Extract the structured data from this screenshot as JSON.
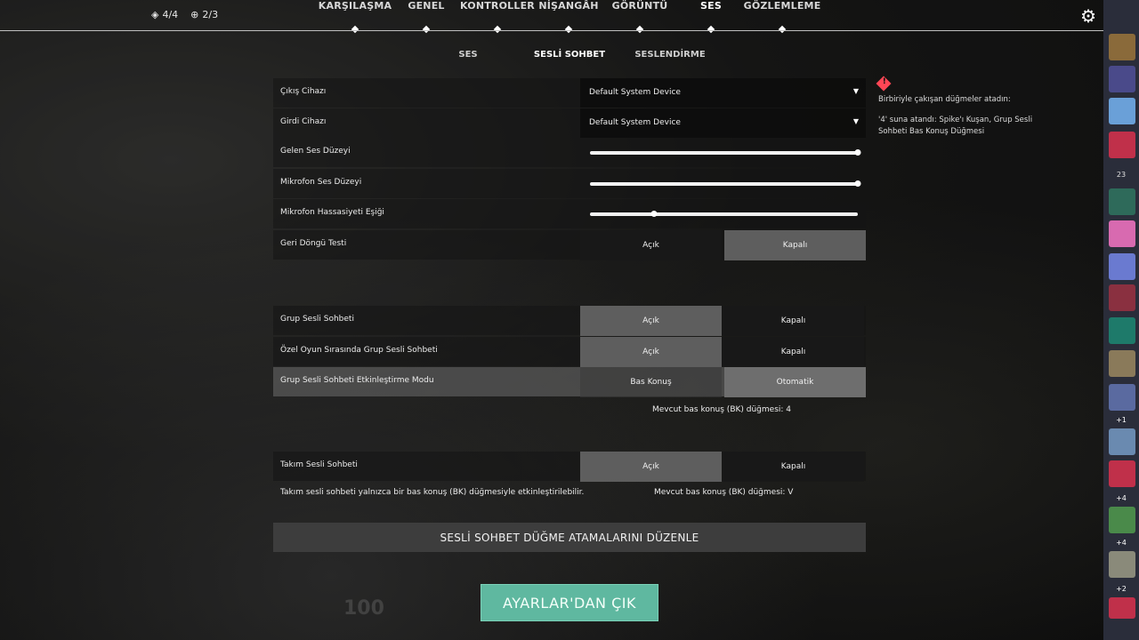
{
  "header": {
    "counters": [
      {
        "icon": "shield-icon",
        "text": "4/4"
      },
      {
        "icon": "plus-circle-icon",
        "text": "2/3"
      }
    ],
    "tabs": [
      {
        "label": "KARŞILAŞMA"
      },
      {
        "label": "GENEL"
      },
      {
        "label": "KONTROLLER"
      },
      {
        "label": "NİŞANGÂH"
      },
      {
        "label": "GÖRÜNTÜ"
      },
      {
        "label": "SES"
      },
      {
        "label": "GÖZLEMLEME"
      }
    ],
    "active_tab": "SES",
    "gear_icon": "gear-icon"
  },
  "sub_tabs": [
    {
      "label": "SES"
    },
    {
      "label": "SESLİ SOHBET"
    },
    {
      "label": "SESLENDİRME"
    }
  ],
  "active_sub_tab": "SESLİ SOHBET",
  "devices": {
    "output_label": "Çıkış Cihazı",
    "output_value": "Default System Device",
    "input_label": "Girdi Cihazı",
    "input_value": "Default System Device"
  },
  "sliders": {
    "incoming_label": "Gelen Ses Düzeyi",
    "incoming_value": 1.0,
    "mic_label": "Mikrofon Ses Düzeyi",
    "mic_value": 1.0,
    "sensitivity_label": "Mikrofon Hassasiyeti Eşiği",
    "sensitivity_value": 0.24
  },
  "loopback": {
    "label": "Geri Döngü Testi",
    "on": "Açık",
    "off": "Kapalı"
  },
  "party": {
    "label": "Grup Sesli Sohbeti",
    "on": "Açık",
    "off": "Kapalı"
  },
  "custom_game_party": {
    "label": "Özel Oyun Sırasında Grup Sesli Sohbeti",
    "on": "Açık",
    "off": "Kapalı"
  },
  "activation_mode": {
    "label": "Grup Sesli Sohbeti Etkinleştirme Modu",
    "ptt": "Bas Konuş",
    "auto": "Otomatik"
  },
  "party_ptt_note": "Mevcut bas konuş (BK) düğmesi: 4",
  "team": {
    "label": "Takım Sesli Sohbeti",
    "on": "Açık",
    "off": "Kapalı"
  },
  "team_note": "Takım sesli sohbeti yalnızca bir bas konuş (BK) düğmesiyle etkinleştirilebilir.",
  "team_ptt_note": "Mevcut bas konuş (BK) düğmesi: V",
  "edit_keybinds": "SESLİ SOHBET DÜĞME ATAMALARINI DÜZENLE",
  "exit_settings": "AYARLAR'DAN ÇIK",
  "warning": {
    "icon": "warning-icon",
    "title": "Birbiriyle çakışan düğmeler atadın:",
    "detail": "'4' suna atandı: Spike'ı Kuşan, Grup Sesli Sohbeti Bas Konuş Düğmesi"
  },
  "sidebar": {
    "count_a": "23",
    "tags": [
      "+1",
      "+4",
      "+4",
      "+2"
    ]
  },
  "background_text": "100",
  "colors": {
    "accent": "#5fb8a0",
    "warning": "#ff4655",
    "sidebar": "#2a2d3a"
  }
}
